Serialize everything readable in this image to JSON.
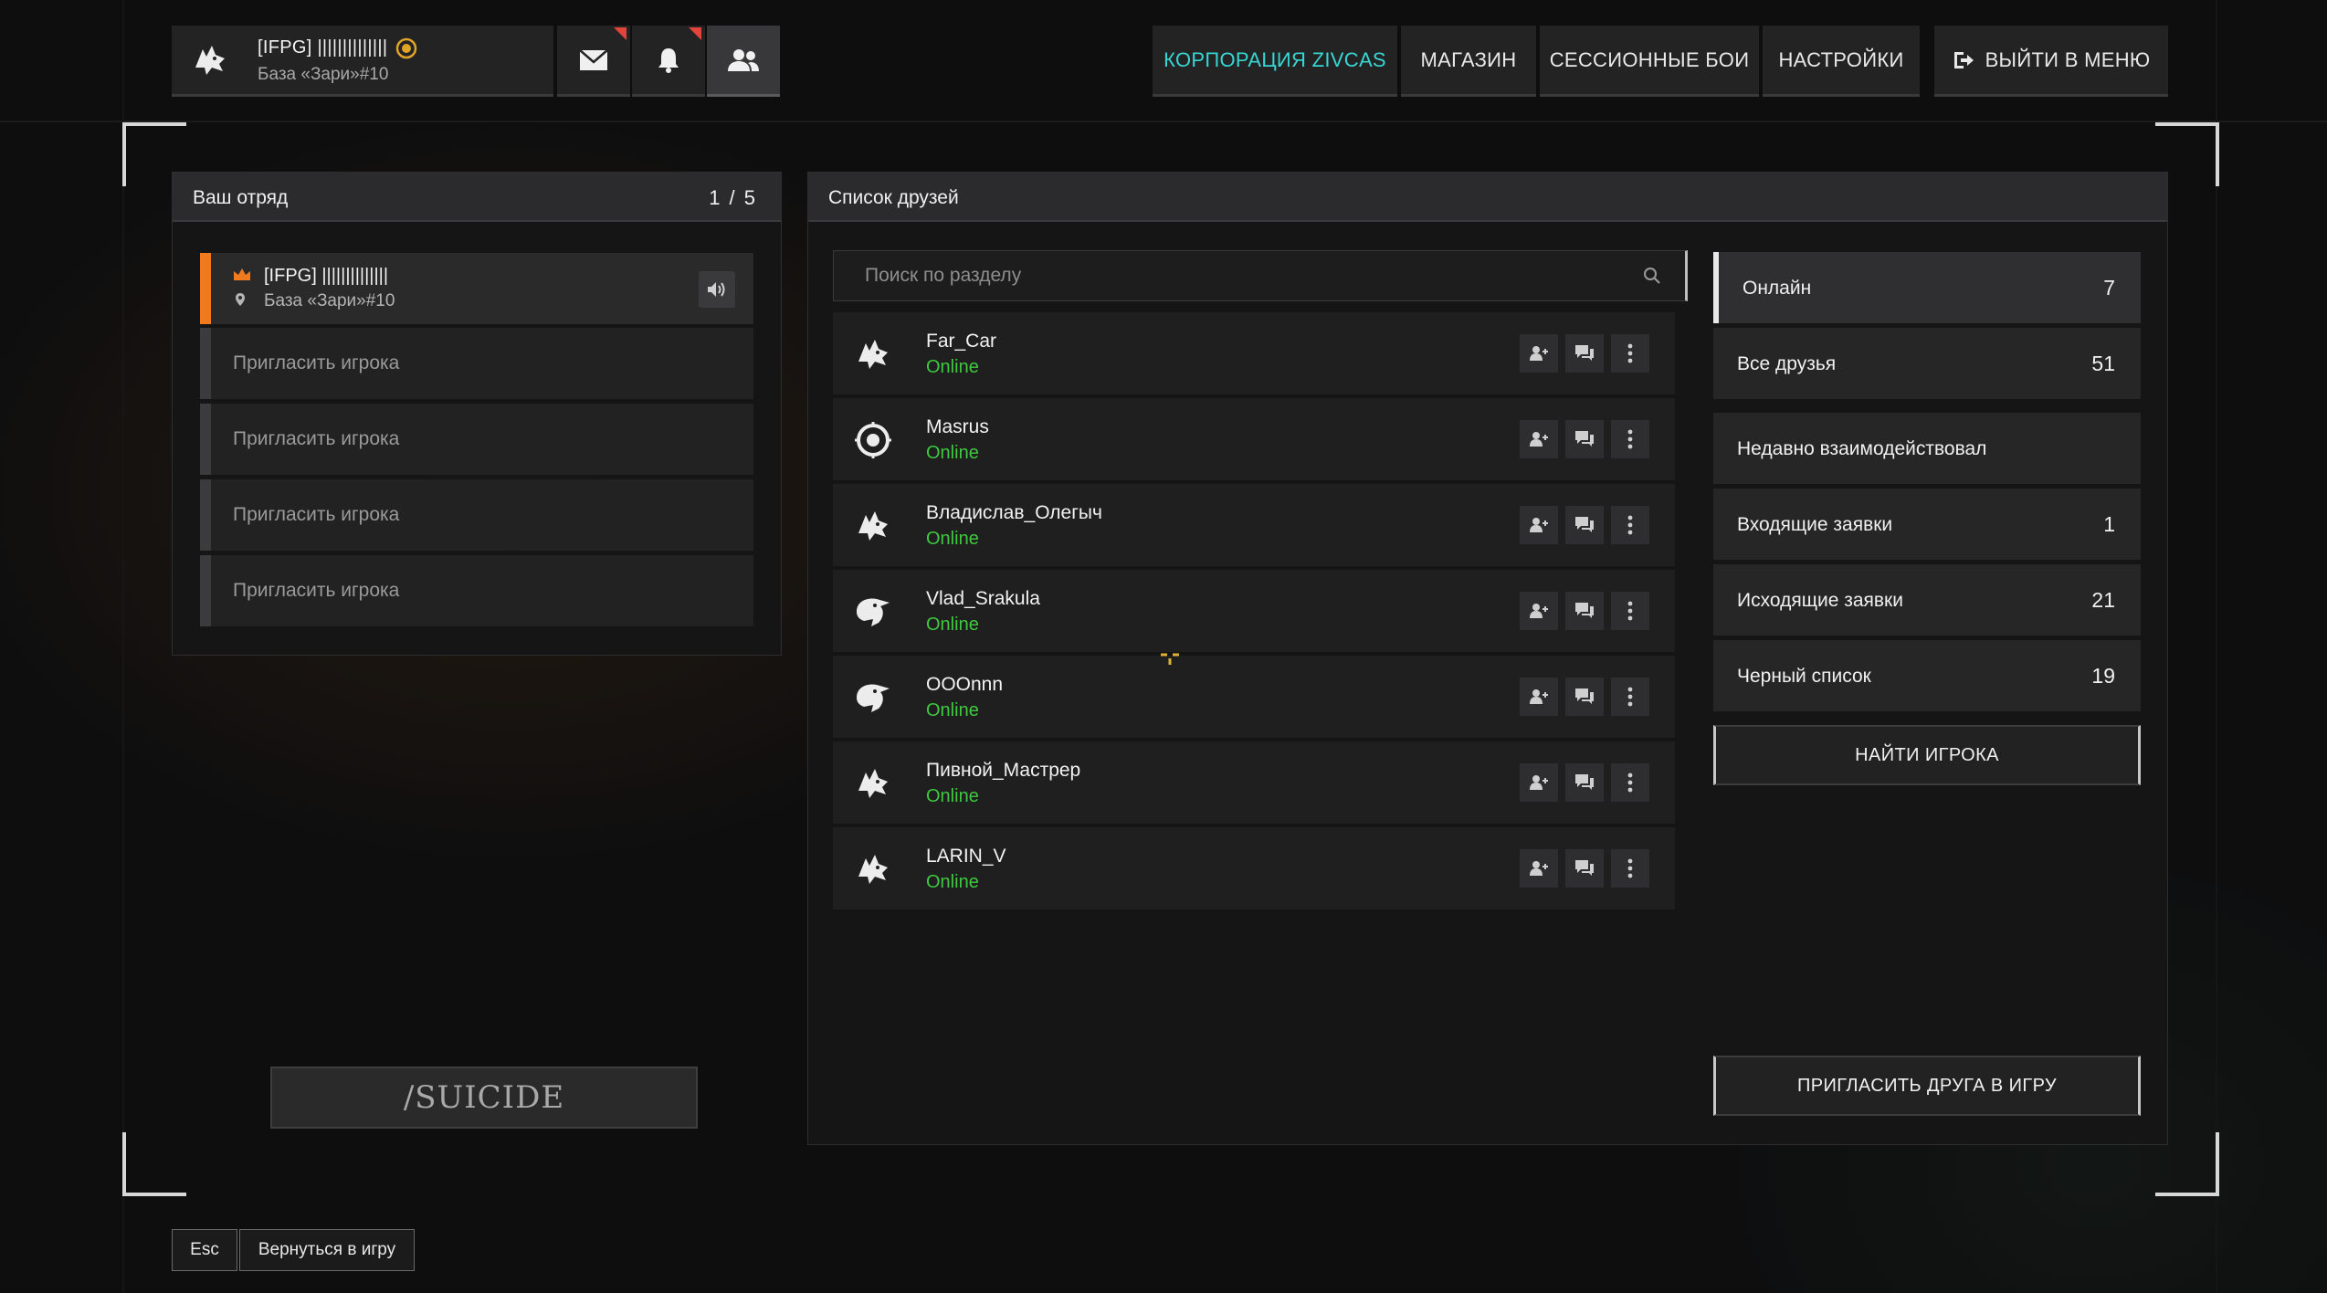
{
  "profile": {
    "name": "[IFPG] ||||||||||||||",
    "location": "База «Зари»#10",
    "avatar_icon": "wolf-head-icon",
    "rank_icon": "rank-badge-icon"
  },
  "top_buttons": {
    "mail_icon": "envelope-icon",
    "notifications_icon": "bell-icon",
    "friends_icon": "users-icon"
  },
  "nav": {
    "corporation": "КОРПОРАЦИЯ ZIVCAS",
    "shop": "МАГАЗИН",
    "session_battles": "СЕССИОННЫЕ БОИ",
    "settings": "НАСТРОЙКИ",
    "exit": "ВЫЙТИ В МЕНЮ"
  },
  "squad": {
    "title": "Ваш отряд",
    "count": "1 / 5",
    "leader": {
      "name": "[IFPG] ||||||||||||||",
      "location": "База «Зари»#10"
    },
    "invite_slots": [
      "Пригласить игрока",
      "Пригласить игрока",
      "Пригласить игрока",
      "Пригласить игрока"
    ],
    "suicide_label": "/SUICIDE"
  },
  "friends": {
    "title": "Список друзей",
    "search_placeholder": "Поиск по разделу",
    "list": [
      {
        "name": "Far_Car",
        "status": "Online",
        "avatar": "wolf-head-icon"
      },
      {
        "name": "Masrus",
        "status": "Online",
        "avatar": "emblem-icon"
      },
      {
        "name": "Владислав_Олегыч",
        "status": "Online",
        "avatar": "wolf-head-icon"
      },
      {
        "name": "Vlad_Srakula",
        "status": "Online",
        "avatar": "eagle-head-icon"
      },
      {
        "name": "OOOnnn",
        "status": "Online",
        "avatar": "eagle-head-icon"
      },
      {
        "name": "Пивной_Мастрер",
        "status": "Online",
        "avatar": "wolf-head-icon"
      },
      {
        "name": "LARIN_V",
        "status": "Online",
        "avatar": "wolf-head-icon"
      }
    ]
  },
  "categories": [
    {
      "label": "Онлайн",
      "count": "7"
    },
    {
      "label": "Все друзья",
      "count": "51"
    },
    {
      "label": "Недавно взаимодействовал",
      "count": ""
    },
    {
      "label": "Входящие заявки",
      "count": "1"
    },
    {
      "label": "Исходящие заявки",
      "count": "21"
    },
    {
      "label": "Черный список",
      "count": "19"
    }
  ],
  "find_player": "НАЙТИ ИГРОКА",
  "invite_friend": "ПРИГЛАСИТЬ ДРУГА В ИГРУ",
  "footer": {
    "esc_key": "Esc",
    "back_label": "Вернуться в игру"
  },
  "colors": {
    "accent_cyan": "#37d6d3",
    "leader_orange": "#f07a1e",
    "online_green": "#3ec93e",
    "notification_red": "#e2433b"
  }
}
